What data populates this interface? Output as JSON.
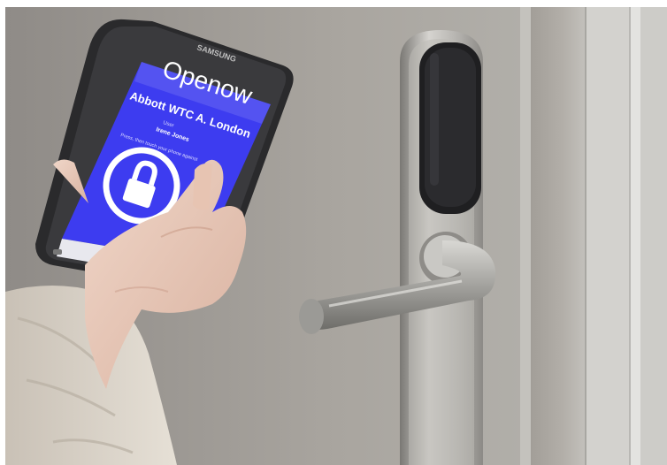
{
  "phone": {
    "brand": "SAMSUNG",
    "app_logo": "Openow",
    "location": "Abbott WTC A. London",
    "user_label": "User",
    "user_name": "Irene Jones",
    "instruction": "Press, then touch your phone against",
    "lock_icon": "padlock-icon",
    "screen_color": "#3d3cf0"
  },
  "scene": {
    "objects": [
      "door-lock-reader",
      "door-handle",
      "hand-holding-phone"
    ]
  }
}
